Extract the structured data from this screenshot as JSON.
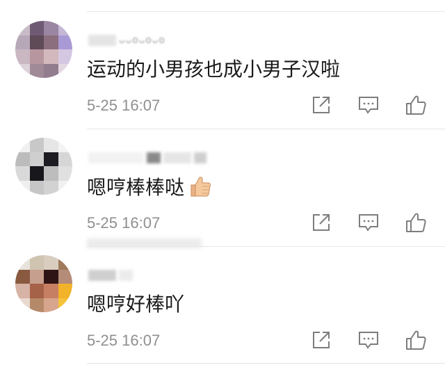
{
  "comments": [
    {
      "username": "ᴗᴗoᴗoᴗo",
      "text": "运动的小男孩也成小男子汉啦",
      "time": "5-25 16:07",
      "has_thumb_emoji": false,
      "actions": [
        "share-icon",
        "comment-icon",
        "like-icon"
      ]
    },
    {
      "username": "",
      "text": "嗯哼棒棒哒",
      "time": "5-25 16:07",
      "has_thumb_emoji": true,
      "actions": [
        "share-icon",
        "comment-icon",
        "like-icon"
      ]
    },
    {
      "username": "",
      "text": "嗯哼好棒吖",
      "time": "5-25 16:07",
      "has_thumb_emoji": false,
      "actions": [
        "share-icon",
        "comment-icon",
        "like-icon"
      ]
    }
  ]
}
